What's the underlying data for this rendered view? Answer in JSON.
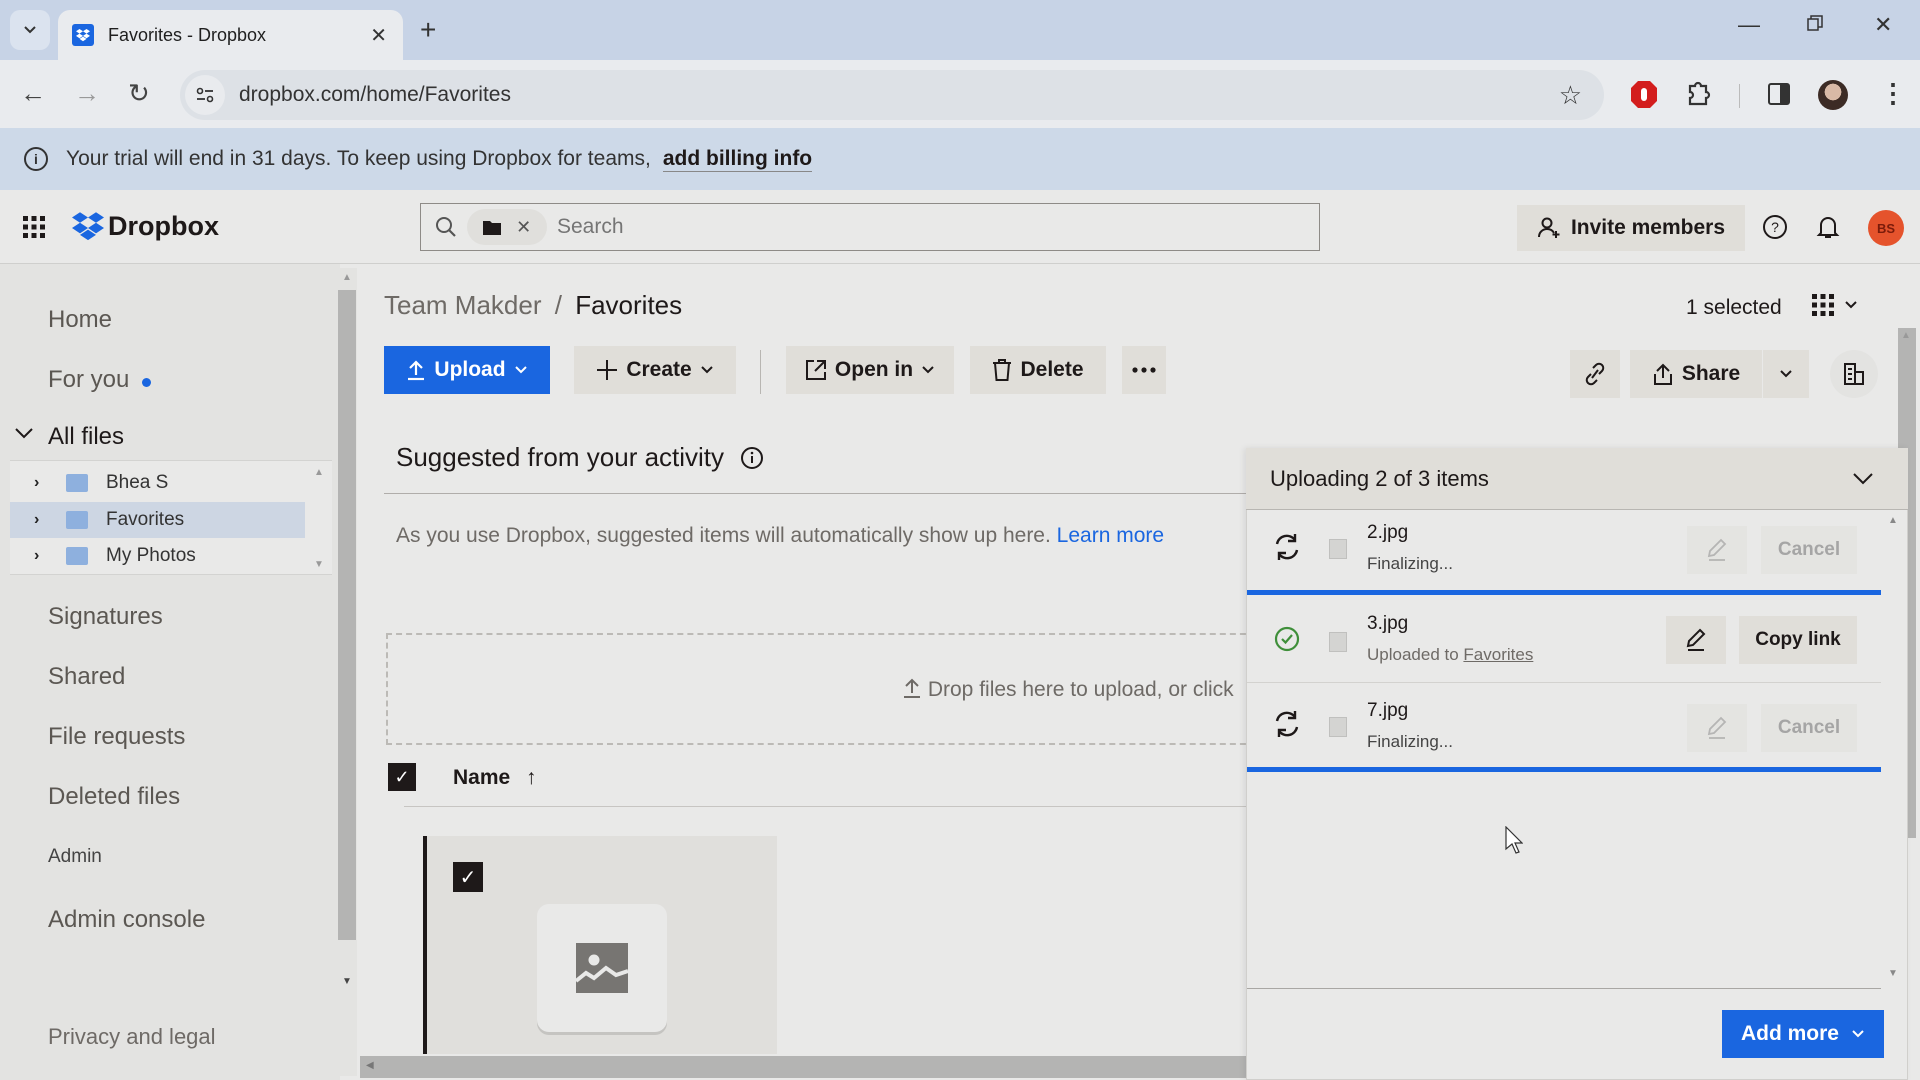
{
  "browser": {
    "tab_title": "Favorites - Dropbox",
    "url": "dropbox.com/home/Favorites"
  },
  "banner": {
    "text": "Your trial will end in 31 days. To keep using Dropbox for teams,",
    "link": "add billing info"
  },
  "header": {
    "logo": "Dropbox",
    "search_placeholder": "Search",
    "invite_label": "Invite members",
    "avatar_initials": "BS",
    "avatar_color": "#e5532c"
  },
  "sidebar": {
    "items": [
      {
        "label": "Home"
      },
      {
        "label": "For you"
      },
      {
        "label": "All files"
      },
      {
        "label": "Signatures"
      },
      {
        "label": "Shared"
      },
      {
        "label": "File requests"
      },
      {
        "label": "Deleted files"
      },
      {
        "label": "Admin"
      },
      {
        "label": "Admin console"
      },
      {
        "label": "Privacy and legal"
      }
    ],
    "tree": [
      {
        "label": "Bhea S",
        "selected": false
      },
      {
        "label": "Favorites",
        "selected": true
      },
      {
        "label": "My Photos",
        "selected": false
      }
    ]
  },
  "main": {
    "breadcrumb_parent": "Team Makder",
    "breadcrumb_sep": "/",
    "breadcrumb_current": "Favorites",
    "selected_count": "1 selected",
    "toolbar": {
      "upload": "Upload",
      "create": "Create",
      "open_in": "Open in",
      "delete": "Delete",
      "share": "Share"
    },
    "suggested_title": "Suggested from your activity",
    "suggested_text": "As you use Dropbox, suggested items will automatically show up here.",
    "learn_more": "Learn more",
    "drop_text": "Drop files here to upload, or click",
    "name_header": "Name"
  },
  "upload_panel": {
    "title": "Uploading 2 of 3 items",
    "items": [
      {
        "name": "2.jpg",
        "status": "Finalizing...",
        "action": "Cancel",
        "state": "uploading",
        "progress": 1.0
      },
      {
        "name": "3.jpg",
        "status_prefix": "Uploaded to",
        "status_link": "Favorites",
        "action": "Copy link",
        "state": "done"
      },
      {
        "name": "7.jpg",
        "status": "Finalizing...",
        "action": "Cancel",
        "state": "uploading",
        "progress": 1.0
      }
    ],
    "add_more": "Add more"
  },
  "colors": {
    "accent": "#1a66e0",
    "success": "#3f8f3a"
  }
}
